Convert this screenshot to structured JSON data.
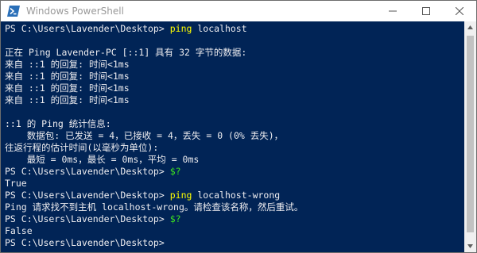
{
  "window": {
    "title": "Windows PowerShell",
    "minimize_symbol": "—",
    "maximize_symbol": "☐",
    "close_symbol": "✕"
  },
  "colors": {
    "console_background": "#012456",
    "console_text": "#eeedf0",
    "command_color": "#ffff00",
    "variable_color": "#3de61e",
    "titlebar_text": "#999999"
  },
  "console": {
    "lines": [
      {
        "prompt": "PS C:\\Users\\Lavender\\Desktop> ",
        "command": "ping",
        "args": " localhost"
      },
      {
        "text": ""
      },
      {
        "text": "正在 Ping Lavender-PC [::1] 具有 32 字节的数据:"
      },
      {
        "text": "来自 ::1 的回复: 时间<1ms"
      },
      {
        "text": "来自 ::1 的回复: 时间<1ms"
      },
      {
        "text": "来自 ::1 的回复: 时间<1ms"
      },
      {
        "text": "来自 ::1 的回复: 时间<1ms"
      },
      {
        "text": ""
      },
      {
        "text": "::1 的 Ping 统计信息:"
      },
      {
        "text": "    数据包: 已发送 = 4，已接收 = 4，丢失 = 0 (0% 丢失)，"
      },
      {
        "text": "往返行程的估计时间(以毫秒为单位):"
      },
      {
        "text": "    最短 = 0ms，最长 = 0ms，平均 = 0ms"
      },
      {
        "prompt": "PS C:\\Users\\Lavender\\Desktop> ",
        "variable": "$?"
      },
      {
        "text": "True"
      },
      {
        "prompt": "PS C:\\Users\\Lavender\\Desktop> ",
        "command": "ping",
        "args": " localhost-wrong"
      },
      {
        "text": "Ping 请求找不到主机 localhost-wrong。请检查该名称，然后重试。"
      },
      {
        "prompt": "PS C:\\Users\\Lavender\\Desktop> ",
        "variable": "$?"
      },
      {
        "text": "False"
      },
      {
        "prompt": "PS C:\\Users\\Lavender\\Desktop> "
      }
    ]
  }
}
